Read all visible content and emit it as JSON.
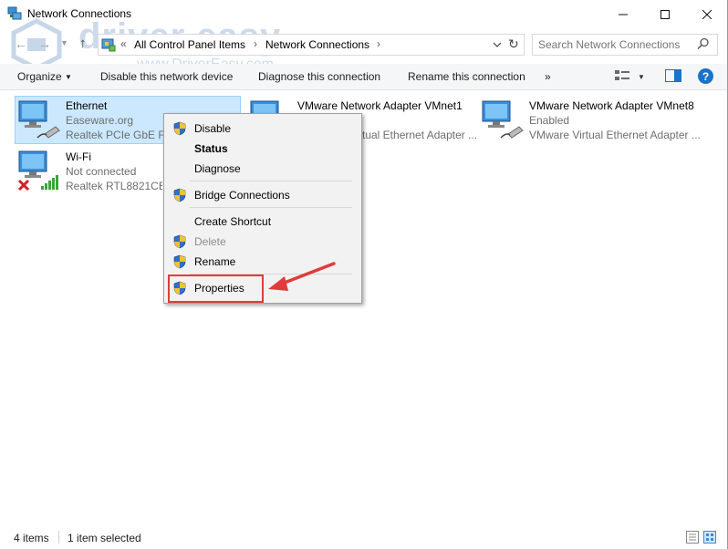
{
  "window": {
    "title": "Network Connections",
    "minimize_icon": "minimize-icon",
    "maximize_icon": "maximize-icon",
    "close_icon": "close-icon"
  },
  "watermark": {
    "logo_text": "driver easy",
    "url_text": "www.DriverEasy.com"
  },
  "address_bar": {
    "overflow": "«",
    "crumbs": [
      "All Control Panel Items",
      "Network Connections"
    ],
    "search_placeholder": "Search Network Connections"
  },
  "command_bar": {
    "organize": "Organize",
    "disable": "Disable this network device",
    "diagnose": "Diagnose this connection",
    "rename": "Rename this connection",
    "more": "»"
  },
  "connections": [
    {
      "name": "Ethernet",
      "status": "Easeware.org",
      "device": "Realtek PCIe GbE Fam"
    },
    {
      "name": "Wi-Fi",
      "status": "Not connected",
      "device": "Realtek RTL8821CE 8"
    },
    {
      "name": "VMware Network Adapter VMnet1",
      "status": "",
      "device": "tual Ethernet Adapter ..."
    },
    {
      "name": "VMware Network Adapter VMnet8",
      "status": "Enabled",
      "device": "VMware Virtual Ethernet Adapter ..."
    }
  ],
  "context_menu": {
    "disable": "Disable",
    "status": "Status",
    "diagnose": "Diagnose",
    "bridge": "Bridge Connections",
    "shortcut": "Create Shortcut",
    "delete": "Delete",
    "rename": "Rename",
    "properties": "Properties"
  },
  "status_bar": {
    "count": "4 items",
    "selected": "1 item selected"
  },
  "colors": {
    "selection_bg": "#cce8ff",
    "annotation_red": "#e03c3c",
    "help_blue": "#1a73c9"
  }
}
